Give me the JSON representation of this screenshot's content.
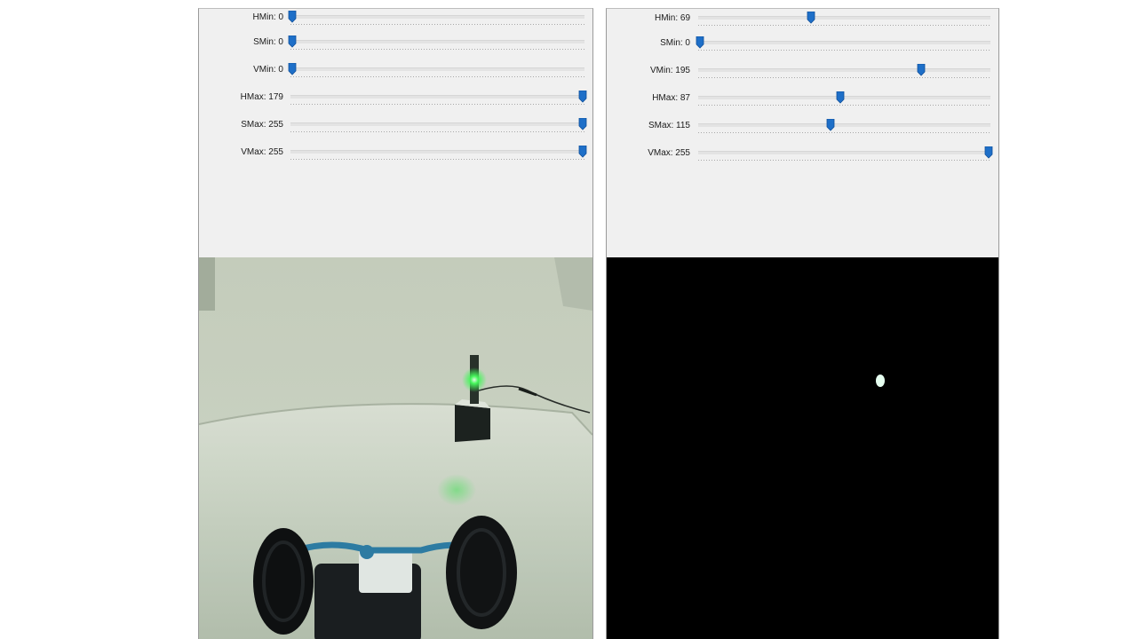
{
  "left_window": {
    "trackbars": [
      {
        "label": "HMin: 0",
        "value": 0,
        "max": 179
      },
      {
        "label": "SMin: 0",
        "value": 0,
        "max": 255
      },
      {
        "label": "VMin: 0",
        "value": 0,
        "max": 255
      },
      {
        "label": "HMax: 179",
        "value": 179,
        "max": 179
      },
      {
        "label": "SMax: 255",
        "value": 255,
        "max": 255
      },
      {
        "label": "VMax: 255",
        "value": 255,
        "max": 255
      }
    ]
  },
  "right_window": {
    "trackbars": [
      {
        "label": "HMin: 69",
        "value": 69,
        "max": 179
      },
      {
        "label": "SMin: 0",
        "value": 0,
        "max": 255
      },
      {
        "label": "VMin: 195",
        "value": 195,
        "max": 255
      },
      {
        "label": "HMax: 87",
        "value": 87,
        "max": 179
      },
      {
        "label": "SMax: 115",
        "value": 115,
        "max": 255
      },
      {
        "label": "VMax: 255",
        "value": 255,
        "max": 255
      }
    ]
  },
  "colors": {
    "thumb": "#1e6fc8",
    "panel_bg": "#f0f0f0",
    "mask_bg": "#000000",
    "led_green": "#39ff5a"
  }
}
